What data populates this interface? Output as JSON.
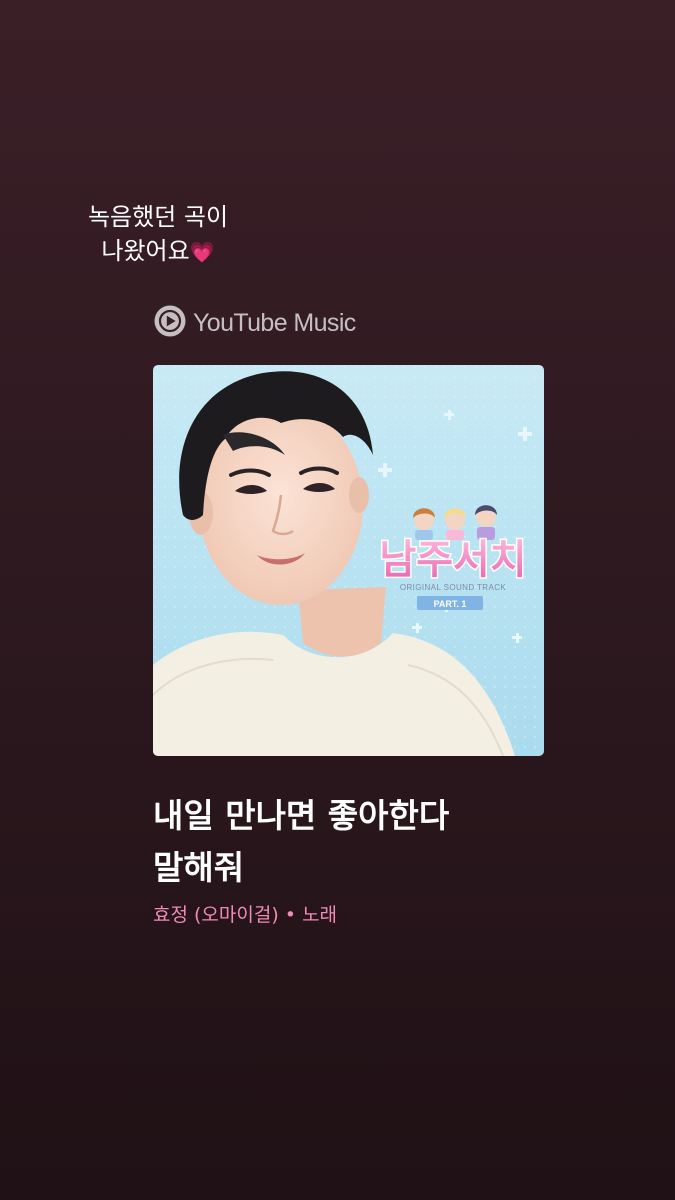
{
  "story": {
    "caption_line1": "녹음했던 곡이",
    "caption_line2": "나왔어요",
    "caption_emoji": "💗"
  },
  "brand": {
    "label": "YouTube Music",
    "icon": "youtube-music-icon",
    "color": "#c6bfc1"
  },
  "album_art": {
    "show_title": "남주서치",
    "subtitle": "ORIGINAL SOUND TRACK",
    "part_label": "PART. 1"
  },
  "track": {
    "title_line1": "내일 만나면 좋아한다",
    "title_line2": "말해줘",
    "artist": "효정 (오마이걸)",
    "separator": "•",
    "type": "노래"
  },
  "colors": {
    "background_top": "#3b1f27",
    "background_bottom": "#1f1115",
    "meta_pink": "#f08bb8",
    "art_sky": "#bfe6f3"
  }
}
